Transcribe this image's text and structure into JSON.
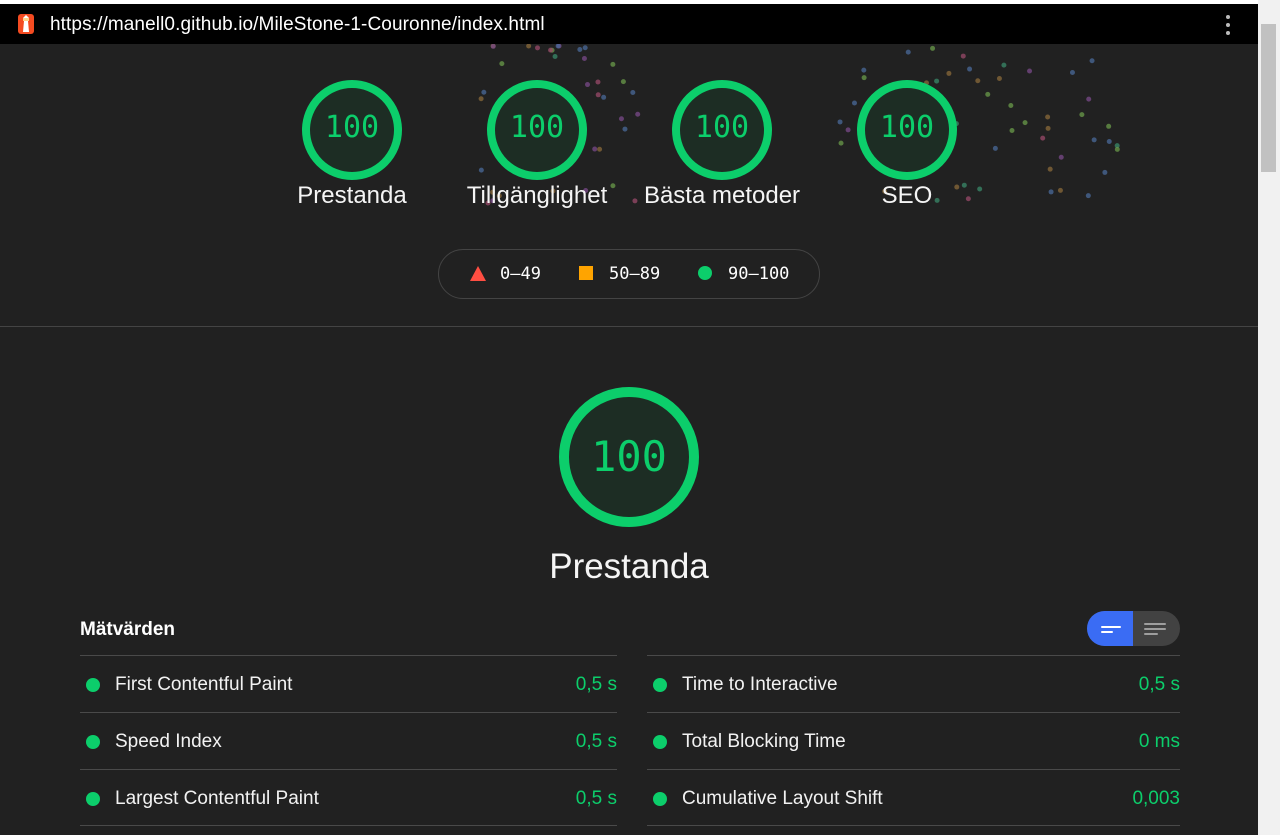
{
  "topbar": {
    "url": "https://manell0.github.io/MileStone-1-Couronne/index.html",
    "icon": "lighthouse-icon",
    "menu_icon": "more-vert-icon"
  },
  "categories": [
    {
      "score": "100",
      "label": "Prestanda"
    },
    {
      "score": "100",
      "label": "Tillgänglighet"
    },
    {
      "score": "100",
      "label": "Bästa metoder"
    },
    {
      "score": "100",
      "label": "SEO"
    }
  ],
  "legend": {
    "fail": "0–49",
    "average": "50–89",
    "pass": "90–100"
  },
  "colors": {
    "pass": "#0cce6b",
    "average": "#ffa400",
    "fail": "#ff4e42",
    "toggle_active": "#3a6cf4"
  },
  "main": {
    "score": "100",
    "title": "Prestanda"
  },
  "metrics": {
    "heading": "Mätvärden",
    "left": [
      {
        "name": "First Contentful Paint",
        "value": "0,5 s"
      },
      {
        "name": "Speed Index",
        "value": "0,5 s"
      },
      {
        "name": "Largest Contentful Paint",
        "value": "0,5 s"
      }
    ],
    "right": [
      {
        "name": "Time to Interactive",
        "value": "0,5 s"
      },
      {
        "name": "Total Blocking Time",
        "value": "0 ms"
      },
      {
        "name": "Cumulative Layout Shift",
        "value": "0,003"
      }
    ]
  }
}
